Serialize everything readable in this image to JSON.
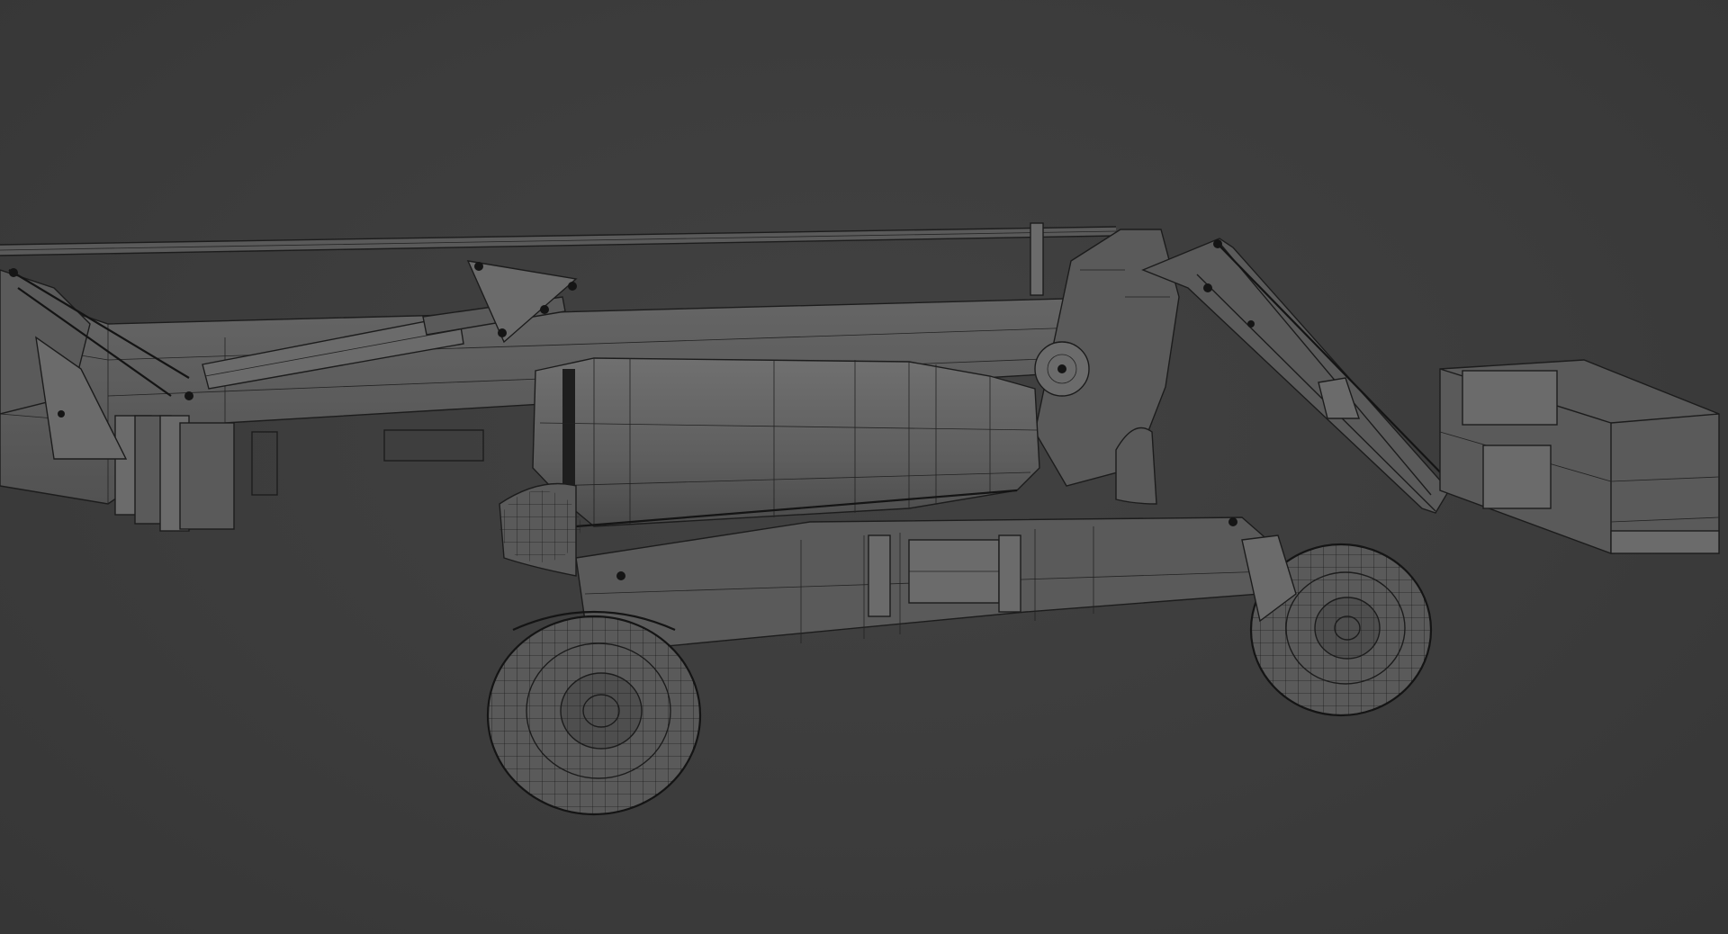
{
  "viewport": {
    "background_color": "#3b3b3b",
    "shading": "wireframe-on-shaded",
    "wire_color": "#1c1c1c",
    "surface_color": "#5a5a5a"
  },
  "model": {
    "subject": "articulating-boom-lift",
    "parts": [
      "main-boom",
      "lift-cylinder",
      "counterweight",
      "turntable",
      "chassis",
      "front-wheel",
      "rear-wheel",
      "jib",
      "platform-basket"
    ]
  }
}
